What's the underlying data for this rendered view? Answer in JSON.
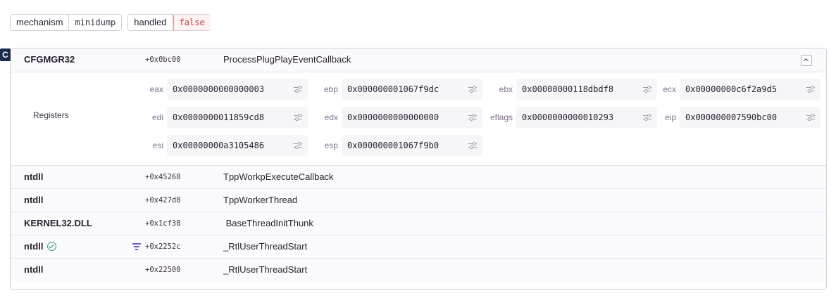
{
  "tags": [
    {
      "key": "mechanism",
      "value": "minidump"
    },
    {
      "key": "handled",
      "value": "false"
    }
  ],
  "platform_badge": "C",
  "frames": [
    {
      "package": "CFGMGR32",
      "address": "+0x0bc00",
      "function": "ProcessPlugPlayEventCallback",
      "expanded": true
    },
    {
      "package": "ntdll",
      "address": "+0x45268",
      "function": "TppWorkpExecuteCallback"
    },
    {
      "package": "ntdll",
      "address": "+0x427d8",
      "function": "TppWorkerThread"
    },
    {
      "package": "KERNEL32.DLL",
      "address": "+0x1cf38",
      "function": " BaseThreadInitThunk"
    },
    {
      "package": "ntdll",
      "address": "+0x2252c",
      "function": "_RtlUserThreadStart",
      "in_app_check": true,
      "filter_icon": true
    },
    {
      "package": "ntdll",
      "address": "+0x22500",
      "function": "_RtlUserThreadStart"
    }
  ],
  "registers": {
    "title": "Registers",
    "items": [
      {
        "name": "eax",
        "value": "0x0000000000000003"
      },
      {
        "name": "ebp",
        "value": "0x000000001067f9dc"
      },
      {
        "name": "ebx",
        "value": "0x00000000118dbdf8"
      },
      {
        "name": "ecx",
        "value": "0x00000000c6f2a9d5"
      },
      {
        "name": "edi",
        "value": "0x0000000011859cd8"
      },
      {
        "name": "edx",
        "value": "0x0000000000000000"
      },
      {
        "name": "eflags",
        "value": "0x0000000000010293"
      },
      {
        "name": "eip",
        "value": "0x000000007590bc00"
      },
      {
        "name": "esi",
        "value": "0x00000000a3105486"
      },
      {
        "name": "esp",
        "value": "0x000000001067f9b0"
      }
    ]
  }
}
